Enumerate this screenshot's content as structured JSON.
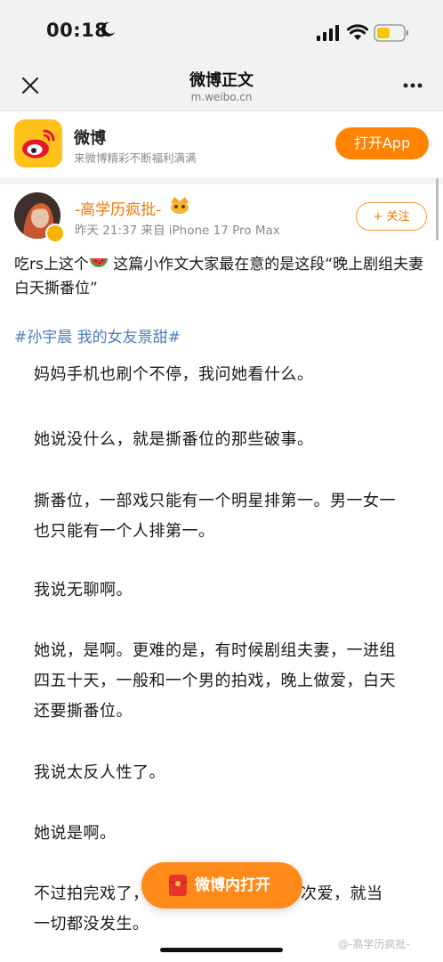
{
  "status_bar": {
    "time": "00:18",
    "icons": [
      "moon-icon",
      "signal-icon",
      "wifi-icon",
      "battery-icon"
    ]
  },
  "nav": {
    "title": "微博正文",
    "subtitle": "m.weibo.cn"
  },
  "app_banner": {
    "name": "微博",
    "tagline": "来微博精彩不断福利满满",
    "open_label": "打开App",
    "accent_color": "#ff8200"
  },
  "post": {
    "author": "-高学历疯批-",
    "meta": "昨天 21:37  来自 iPhone 17 Pro Max",
    "follow_label": "+ 关注",
    "text_before_emoji": "吃rs上这个",
    "text_after_emoji": " 这篇小作文大家最在意的是这段“晚上剧组夫妻 白天撕番位”",
    "hashtag": "#孙宇晨 我的女友景甜#",
    "image_paragraphs": [
      "妈妈手机也刷个不停，我问她看什么。",
      "她说没什么，就是撕番位的那些破事。",
      "撕番位，一部戏只能有一个明星排第一。男一女一也只能有一个人排第一。",
      "我说无聊啊。",
      "她说，是啊。更难的是，有时候剧组夫妻，一进组四五十天，一般和一个男的拍戏，晚上做爱，白天还要撕番位。",
      "我说太反人性了。",
      "她说是啊。",
      "不过拍完戏了，",
      "次爱，就当",
      "一切都没发生。"
    ]
  },
  "floating_button": {
    "label": "微博内打开"
  },
  "watermark": "@-高学历疯批-"
}
